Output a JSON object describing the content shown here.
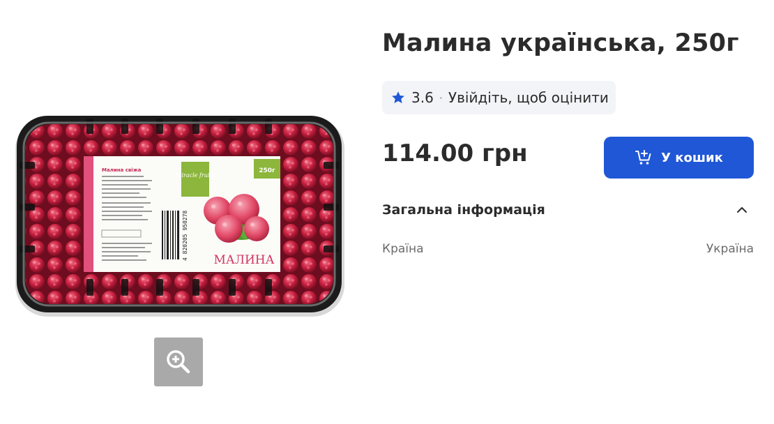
{
  "product": {
    "title": "Малина українська, 250г",
    "image": {
      "label_title": "Малина свіжа",
      "brand": "Miracle fruits",
      "weight": "250г",
      "name_on_label": "МАЛИНА",
      "barcode": "4 820205 950278"
    }
  },
  "rating": {
    "value": "3.6",
    "separator": "·",
    "login_text": "Увійдіть, щоб оцінити",
    "star_color": "#1f57d6"
  },
  "price": {
    "text": "114.00 грн"
  },
  "cart": {
    "label": "У кошик",
    "icon": "cart-plus-icon",
    "color": "#1f57d6"
  },
  "general_info": {
    "title": "Загальна інформація",
    "expanded": true,
    "rows": [
      {
        "label": "Країна",
        "value": "Україна"
      }
    ]
  },
  "zoom": {
    "icon": "zoom-in-icon"
  }
}
